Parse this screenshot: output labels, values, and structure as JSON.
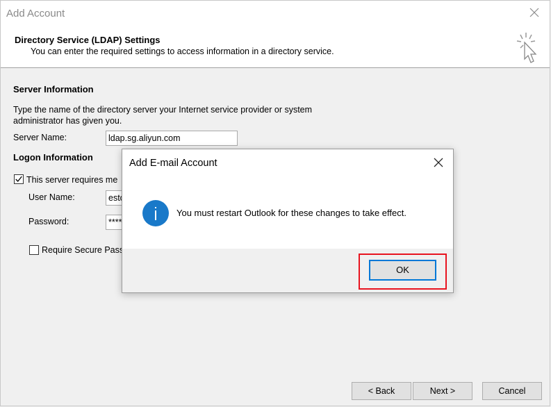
{
  "window": {
    "title": "Add Account"
  },
  "header": {
    "title": "Directory Service (LDAP) Settings",
    "subtitle": "You can enter the required settings to access information in a directory service."
  },
  "server_info": {
    "heading": "Server Information",
    "description": "Type the name of the directory server your Internet service provider or system administrator has given you.",
    "server_name_label": "Server Name:",
    "server_name_value": "ldap.sg.aliyun.com"
  },
  "logon_info": {
    "heading": "Logon Information",
    "requires_logon_label": "This server requires me",
    "requires_logon_checked": true,
    "user_name_label": "User Name:",
    "user_name_value": "estc",
    "password_label": "Password:",
    "password_value": "****",
    "spa_label": "Require Secure Pass",
    "spa_checked": false
  },
  "footer": {
    "back_label": "< Back",
    "next_label": "Next >",
    "cancel_label": "Cancel"
  },
  "modal": {
    "title": "Add E-mail Account",
    "message": "You must restart Outlook for these changes to take effect.",
    "ok_label": "OK",
    "icon": "info-icon",
    "icon_color": "#1979c9",
    "highlight_color": "#e8131f"
  }
}
